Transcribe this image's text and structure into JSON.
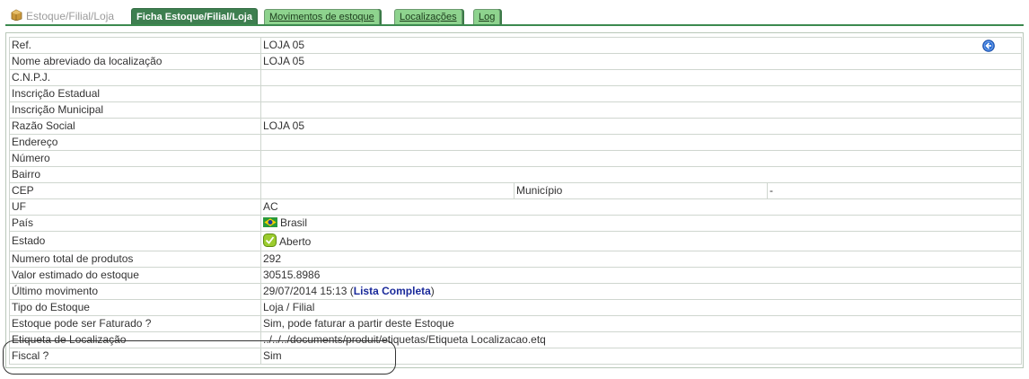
{
  "tabs": {
    "home": "Estoque/Filial/Loja",
    "items": [
      {
        "label": "Ficha Estoque/Filial/Loja",
        "active": true
      },
      {
        "label": "Movimentos de estoque",
        "active": false
      },
      {
        "label": "Localizações",
        "active": false
      },
      {
        "label": "Log",
        "active": false
      }
    ]
  },
  "icons": {
    "home": "box-icon",
    "back": "back-arrow-icon",
    "country_flag": "brazil-flag-icon",
    "status": "check-icon"
  },
  "fields": {
    "ref": {
      "label": "Ref.",
      "value": "LOJA 05"
    },
    "short_name": {
      "label": "Nome abreviado da localização",
      "value": "LOJA 05"
    },
    "cnpj": {
      "label": "C.N.P.J.",
      "value": ""
    },
    "state_reg": {
      "label": "Inscrição Estadual",
      "value": ""
    },
    "municipal_reg": {
      "label": "Inscrição Municipal",
      "value": ""
    },
    "company_name": {
      "label": "Razão Social",
      "value": "LOJA 05"
    },
    "address": {
      "label": "Endereço",
      "value": ""
    },
    "number": {
      "label": "Número",
      "value": ""
    },
    "district": {
      "label": "Bairro",
      "value": ""
    },
    "cep": {
      "label": "CEP",
      "value": "",
      "municipio_label": "Município",
      "municipio_value": "-"
    },
    "uf": {
      "label": "UF",
      "value": "AC"
    },
    "country": {
      "label": "País",
      "value": "Brasil"
    },
    "state": {
      "label": "Estado",
      "value": "Aberto"
    },
    "total_products": {
      "label": "Numero total de produtos",
      "value": "292"
    },
    "stock_value": {
      "label": "Valor estimado do estoque",
      "value": "30515.8986"
    },
    "last_movement": {
      "label": "Último movimento",
      "value": "29/07/2014 15:13",
      "open_paren": "(",
      "link": "Lista Completa",
      "close_paren": ")"
    },
    "stock_type": {
      "label": "Tipo do Estoque",
      "value": "Loja / Filial"
    },
    "billable": {
      "label": "Estoque pode ser Faturado ?",
      "value": "Sim, pode faturar a partir deste Estoque"
    },
    "label_tag": {
      "label": "Etiqueta de Localização",
      "value": "../../../documents/produit/etiquetas/Etiqueta Localizacao.etq"
    },
    "fiscal": {
      "label": "Fiscal ?",
      "value": "Sim"
    }
  },
  "colors": {
    "active_tab": "#3e7f50",
    "inactive_tab": "#8ed38e",
    "link": "#1a2a9a",
    "back_icon": "#2b6fd6"
  }
}
